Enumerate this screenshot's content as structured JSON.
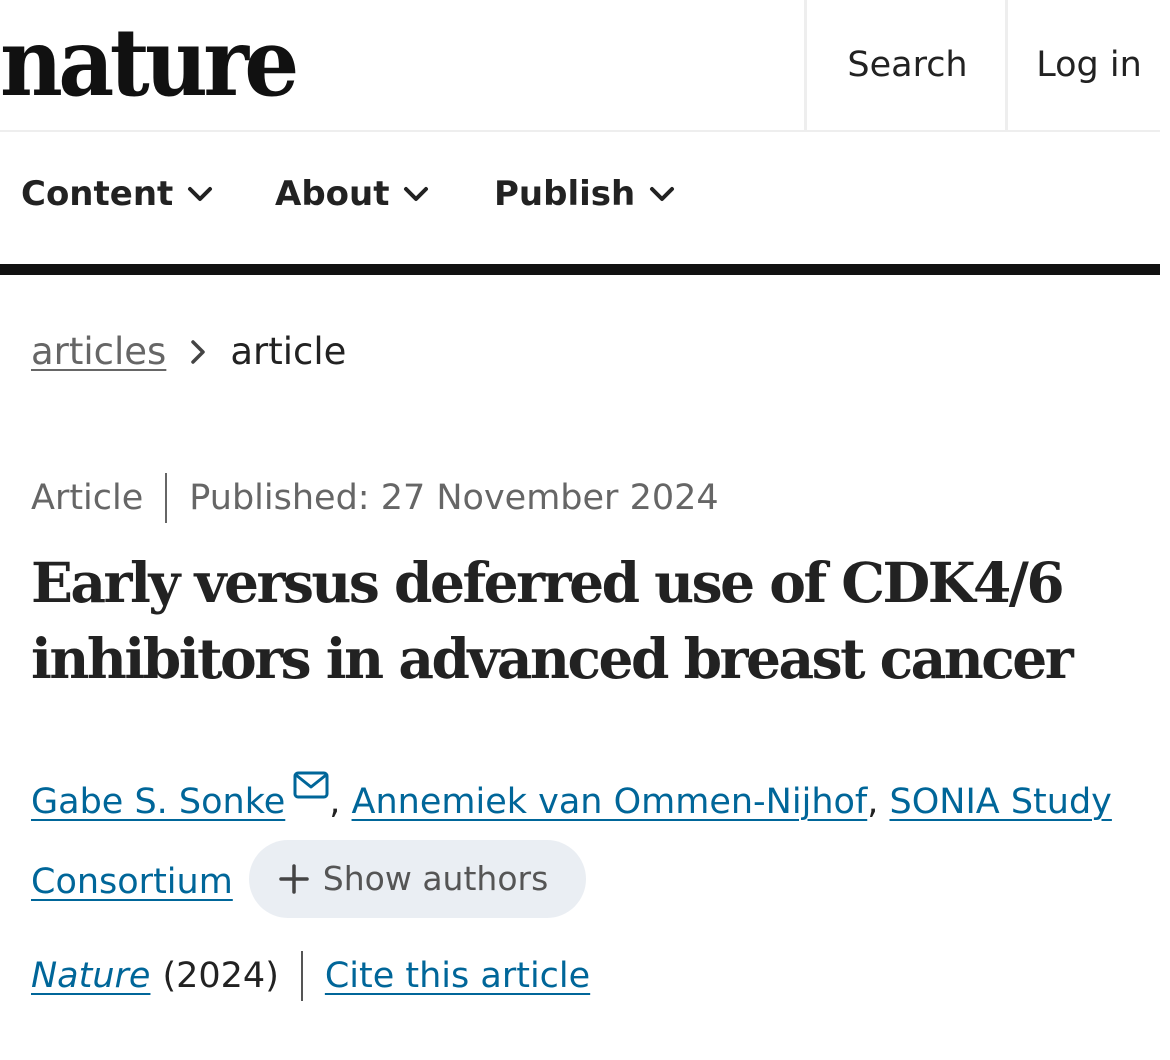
{
  "header": {
    "logo": "nature",
    "search_label": "Search",
    "login_label": "Log in"
  },
  "nav": {
    "items": [
      {
        "label": "Content",
        "icon": "chevron-down-icon"
      },
      {
        "label": "About",
        "icon": "chevron-down-icon"
      },
      {
        "label": "Publish",
        "icon": "chevron-down-icon"
      }
    ]
  },
  "breadcrumb": {
    "items": [
      "articles",
      "article"
    ],
    "separator_icon": "chevron-right-icon"
  },
  "article": {
    "type": "Article",
    "published": "Published: 27 November 2024",
    "title": "Early versus deferred use of CDK4/6 inhibitors in advanced breast cancer",
    "authors": [
      {
        "name": "Gabe S. Sonke",
        "icon": "mail-icon"
      },
      {
        "name": "Annemiek van Ommen-Nijhof"
      },
      {
        "name": "SONIA Study Consortium"
      }
    ],
    "show_authors_label": "Show authors",
    "show_authors_icon": "plus-icon",
    "journal": "Nature",
    "year": "(2024)",
    "cite_label": "Cite this article"
  },
  "colors": {
    "link": "#006699",
    "muted_text": "#666666",
    "chip_background": "#eaeef3",
    "nav_rule": "#111111"
  }
}
